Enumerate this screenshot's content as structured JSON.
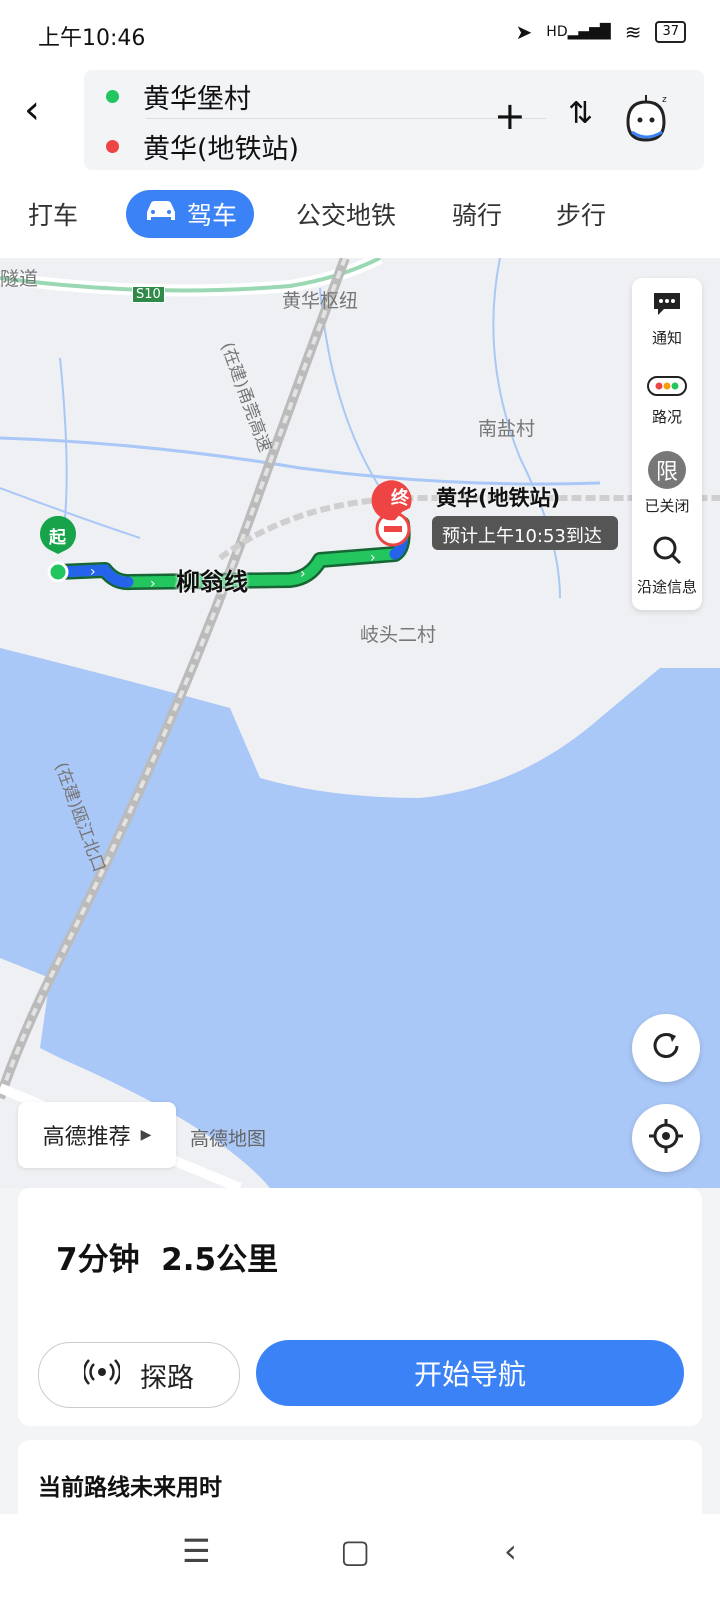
{
  "status_bar": {
    "time": "上午10:46",
    "network": "HD",
    "battery": "37"
  },
  "header": {
    "origin": "黄华堡村",
    "destination": "黄华(地铁站)",
    "origin_color": "#22c55e",
    "destination_color": "#ef4444"
  },
  "modes": {
    "taxi": "打车",
    "drive": "驾车",
    "transit": "公交地铁",
    "cycle": "骑行",
    "walk": "步行"
  },
  "map": {
    "labels": {
      "tunnel": "隧道",
      "s10": "S10",
      "hub": "黄华枢纽",
      "nanyan": "南盐村",
      "qitou": "岐头二村",
      "road_nanguan": "(在建)甬莞高速",
      "road_oujiang": "(在建)瓯江北口",
      "route_name": "柳翁线",
      "start_marker": "起",
      "end_marker": "终",
      "end_name": "黄华(地铁站)",
      "eta": "预计上午10:53到达",
      "watermark": "高德地图"
    },
    "route_color": "#16a34a",
    "route_start_color": "#2563eb",
    "water_color": "#a9c7f7"
  },
  "side_panel": {
    "notice": "通知",
    "traffic": "路况",
    "limit_icon_text": "限",
    "limit": "已关闭",
    "along": "沿途信息"
  },
  "recommend": "高德推荐",
  "summary": {
    "time": "7分钟",
    "distance": "2.5公里"
  },
  "actions": {
    "probe": "探路",
    "start": "开始导航"
  },
  "future": {
    "title": "当前路线未来用时"
  },
  "accent": "#3b82f6"
}
